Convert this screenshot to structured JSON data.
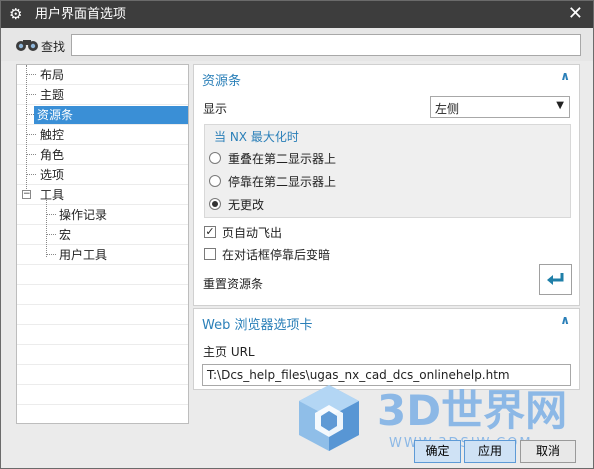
{
  "window": {
    "title": "用户界面首选项",
    "close_symbol": "✕"
  },
  "search": {
    "label": "查找",
    "value": ""
  },
  "tree": [
    {
      "label": "布局",
      "level": 0
    },
    {
      "label": "主题",
      "level": 0
    },
    {
      "label": "资源条",
      "level": 0,
      "selected": true
    },
    {
      "label": "触控",
      "level": 0
    },
    {
      "label": "角色",
      "level": 0
    },
    {
      "label": "选项",
      "level": 0
    },
    {
      "label": "工具",
      "level": 0,
      "expanded": true
    },
    {
      "label": "操作记录",
      "level": 1
    },
    {
      "label": "宏",
      "level": 1
    },
    {
      "label": "用户工具",
      "level": 1
    }
  ],
  "resource_bar": {
    "title": "资源条",
    "display_label": "显示",
    "display_value": "左侧",
    "group_title": "当 NX 最大化时",
    "options": [
      {
        "label": "重叠在第二显示器上",
        "checked": false
      },
      {
        "label": "停靠在第二显示器上",
        "checked": false
      },
      {
        "label": "无更改",
        "checked": true
      }
    ],
    "auto_fly_out_label": "页自动飞出",
    "auto_fly_out_checked": true,
    "dim_label": "在对话框停靠后变暗",
    "dim_checked": false,
    "reset_label": "重置资源条"
  },
  "browser": {
    "title": "Web 浏览器选项卡",
    "home_label": "主页 URL",
    "home_value": "T:\\Dcs_help_files\\ugas_nx_cad_dcs_onlinehelp.htm"
  },
  "buttons": {
    "ok": "确定",
    "apply": "应用",
    "cancel": "取消"
  },
  "watermark": {
    "brand": "3D世界网",
    "url": "WWW.3DSJW.COM"
  },
  "colors": {
    "accent": "#2a7fb8",
    "selection": "#3a8fd6",
    "titlebar": "#3d3d3d"
  }
}
